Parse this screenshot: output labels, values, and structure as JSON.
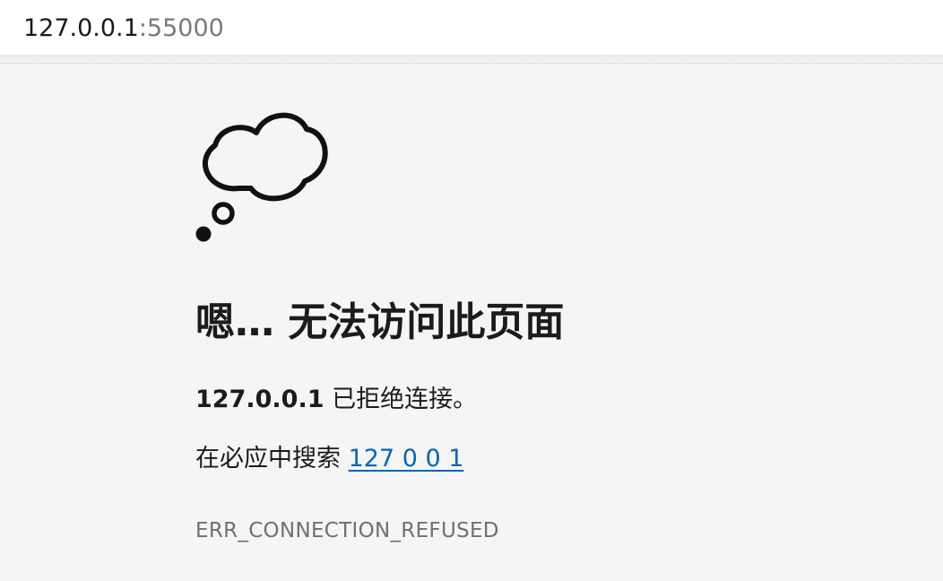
{
  "address_bar": {
    "host": "127.0.0.1",
    "port": ":55000"
  },
  "error_page": {
    "icon": "thought-cloud-icon",
    "heading": "嗯… 无法访问此页面",
    "host_bold": "127.0.0.1",
    "message_suffix": " 已拒绝连接。",
    "search_prefix": "在必应中搜索 ",
    "search_link": "127 0 0 1",
    "error_code": "ERR_CONNECTION_REFUSED",
    "link_color": "#0067b8"
  }
}
